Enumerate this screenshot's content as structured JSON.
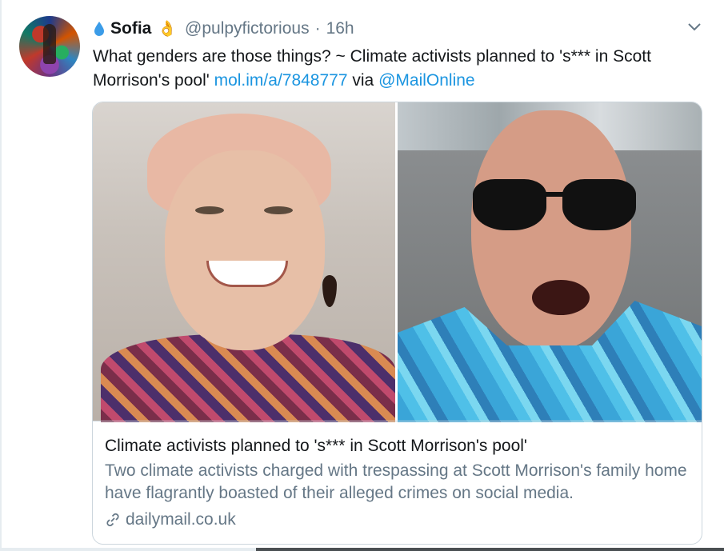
{
  "tweet": {
    "display_name": "Sofia",
    "name_prefix_emoji": "droplet",
    "name_suffix_emoji": "👌",
    "handle": "@pulpyfictorious",
    "separator": "·",
    "time": "16h",
    "text_main": "What genders are those things? ~ Climate activists planned to 's*** in Scott Morrison's pool'",
    "link_url": "mol.im/a/7848777",
    "via_label": "via",
    "mention": "@MailOnline"
  },
  "card": {
    "title": "Climate activists planned to 's*** in Scott Morrison's pool'",
    "description": "Two climate activists charged with trespassing at Scott Morrison's family home have flagrantly boasted of their alleged crimes on social media.",
    "domain": "dailymail.co.uk"
  },
  "colors": {
    "link": "#1b95e0",
    "secondary_text": "#657786",
    "border": "#ccd6dd"
  },
  "icons": {
    "droplet": "droplet-icon",
    "chevron": "chevron-down-icon",
    "link": "link-icon"
  }
}
